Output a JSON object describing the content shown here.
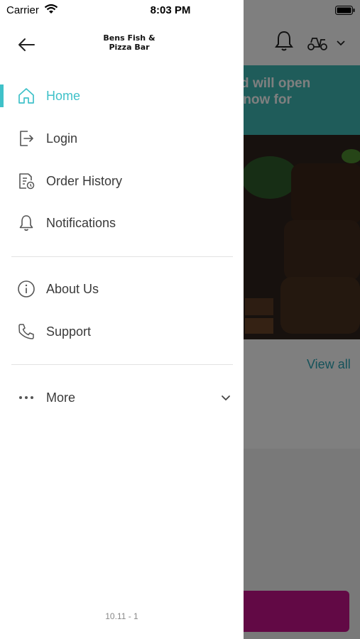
{
  "status_bar": {
    "carrier": "Carrier",
    "time": "8:03 PM"
  },
  "drawer": {
    "logo_text": "Bens Fish &\nPizza Bar",
    "menu": [
      {
        "label": "Home",
        "icon": "home-icon",
        "active": true
      },
      {
        "label": "Login",
        "icon": "login-icon",
        "active": false
      },
      {
        "label": "Order History",
        "icon": "order-history-icon",
        "active": false
      },
      {
        "label": "Notifications",
        "icon": "bell-icon",
        "active": false
      }
    ],
    "secondary_menu": [
      {
        "label": "About Us",
        "icon": "info-icon"
      },
      {
        "label": "Support",
        "icon": "phone-icon"
      }
    ],
    "more": {
      "label": "More",
      "icon": "more-dots-icon"
    },
    "version": "10.11 - 1"
  },
  "background": {
    "banner_text": "d and will open\nrder now for",
    "view_all": "View all"
  },
  "colors": {
    "accent": "#3fc1c9",
    "banner": "#3fb8b5",
    "cta": "#c4138a",
    "text": "#3a3a3a"
  }
}
